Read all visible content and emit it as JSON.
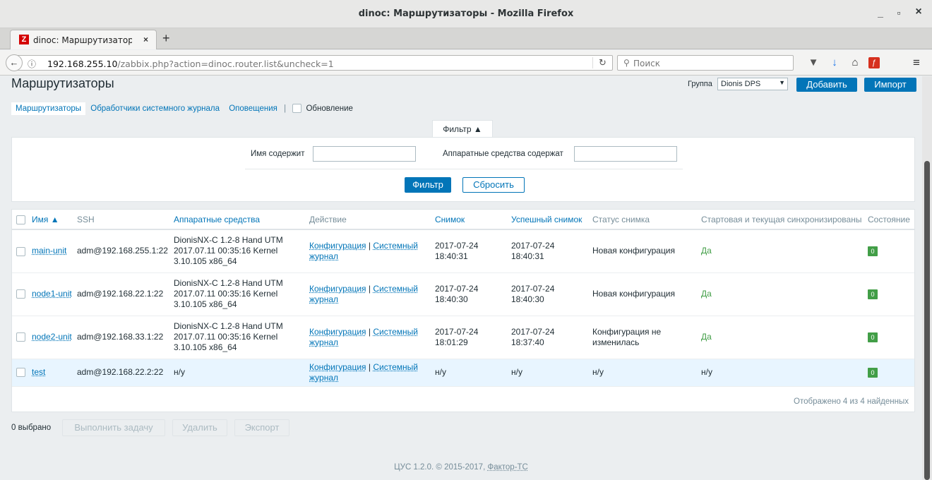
{
  "window": {
    "title": "dinoc: Маршрутизаторы - Mozilla Firefox",
    "minimize": "_",
    "maximize": "▫",
    "close": "×"
  },
  "tab": {
    "favicon": "Z",
    "title": "dinoc: Маршрутизаторы",
    "close": "×",
    "new_tab": "+"
  },
  "nav": {
    "url_host": "192.168.255.10",
    "url_path": "/zabbix.php?action=dinoc.router.list&uncheck=1",
    "search_placeholder": "Поиск",
    "icons": [
      "back-icon",
      "info-icon",
      "reload-icon",
      "search-icon",
      "pocket-icon",
      "download-icon",
      "home-icon",
      "flash-icon",
      "menu-icon"
    ]
  },
  "header": {
    "title": "Маршрутизаторы",
    "group_label": "Группа",
    "group_value": "Dionis DPS",
    "add_label": "Добавить",
    "import_label": "Импорт"
  },
  "subnav": {
    "items": [
      "Маршрутизаторы",
      "Обработчики системного журнала",
      "Оповещения"
    ],
    "separator": "|",
    "refresh_label": "Обновление"
  },
  "filter": {
    "tab_label": "Фильтр ▲",
    "name_label": "Имя содержит",
    "name_value": "",
    "hw_label": "Аппаратные средства содержат",
    "hw_value": "",
    "apply_label": "Фильтр",
    "reset_label": "Сбросить"
  },
  "table": {
    "columns": [
      "Имя ▲",
      "SSH",
      "Аппаратные средства",
      "Действие",
      "Снимок",
      "Успешный снимок",
      "Статус снимка",
      "Стартовая и текущая синхронизированы",
      "Состояние"
    ],
    "action_config": "Конфигурация",
    "action_sep": "|",
    "action_syslog": "Системный журнал",
    "rows": [
      {
        "name": "main-unit",
        "ssh": "adm@192.168.255.1:22",
        "hw": "DionisNX-C 1.2-8 Hand UTM 2017.07.11 00:35:16 Kernel 3.10.105 x86_64",
        "snapshot": "2017-07-24 18:40:31",
        "success": "2017-07-24 18:40:31",
        "status": "Новая конфигурация",
        "sync": "Да",
        "state": "0"
      },
      {
        "name": "node1-unit",
        "ssh": "adm@192.168.22.1:22",
        "hw": "DionisNX-C 1.2-8 Hand UTM 2017.07.11 00:35:16 Kernel 3.10.105 x86_64",
        "snapshot": "2017-07-24 18:40:30",
        "success": "2017-07-24 18:40:30",
        "status": "Новая конфигурация",
        "sync": "Да",
        "state": "0"
      },
      {
        "name": "node2-unit",
        "ssh": "adm@192.168.33.1:22",
        "hw": "DionisNX-C 1.2-8 Hand UTM 2017.07.11 00:35:16 Kernel 3.10.105 x86_64",
        "snapshot": "2017-07-24 18:01:29",
        "success": "2017-07-24 18:37:40",
        "status": "Конфигурация не изменилась",
        "sync": "Да",
        "state": "0"
      },
      {
        "name": "test",
        "ssh": "adm@192.168.22.2:22",
        "hw": "н/у",
        "snapshot": "н/у",
        "success": "н/у",
        "status": "н/у",
        "sync": "н/у",
        "state": "0"
      }
    ],
    "footer": "Отображено 4 из 4 найденных"
  },
  "actions": {
    "selected": "0 выбрано",
    "run_task": "Выполнить задачу",
    "delete": "Удалить",
    "export": "Экспорт"
  },
  "footer": {
    "text": "ЦУС 1.2.0. © 2015-2017, ",
    "link": "Фактор-ТС"
  }
}
